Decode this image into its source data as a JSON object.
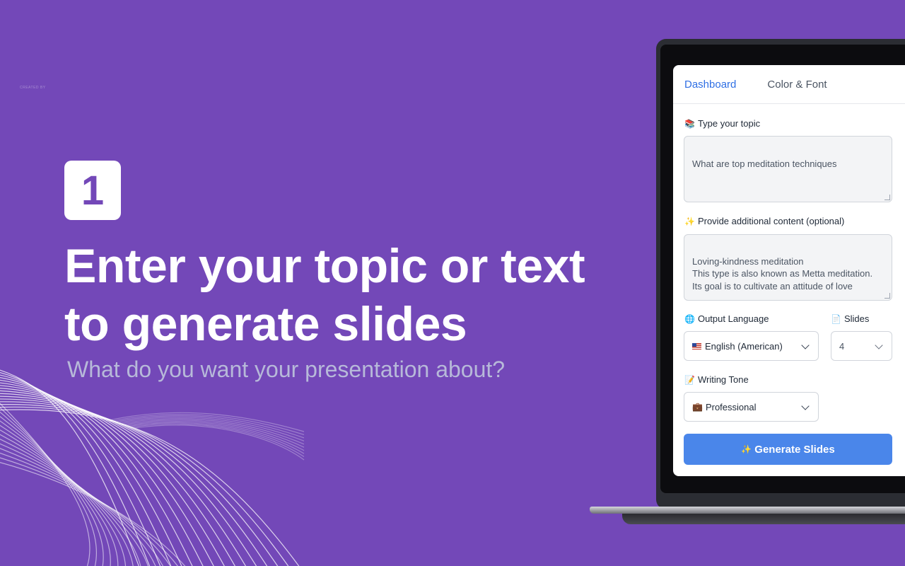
{
  "hero": {
    "created_by": "CREATED BY",
    "step_number": "1",
    "headline": "Enter your topic or text to generate slides",
    "subline": "What do you want your presentation about?"
  },
  "panel": {
    "tabs": [
      {
        "label": "Dashboard",
        "active": true
      },
      {
        "label": "Color & Font",
        "active": false
      }
    ],
    "topic": {
      "icon": "books-icon",
      "label": "Type your topic",
      "value": "What are top meditation techniques"
    },
    "additional": {
      "icon": "sparkles-icon",
      "label": "Provide additional content (optional)",
      "value": "Loving-kindness meditation\nThis type is also known as Metta meditation.\nIts goal is to cultivate an attitude of love"
    },
    "language": {
      "icon": "globe-icon",
      "label": "Output Language",
      "flag_icon": "us-flag-icon",
      "value": "English (American)"
    },
    "slides": {
      "icon": "page-icon",
      "label": "Slides",
      "value": "4"
    },
    "tone": {
      "icon": "memo-icon",
      "label": "Writing Tone",
      "value_icon": "briefcase-icon",
      "value": "Professional"
    },
    "generate_button": {
      "icon": "sparkles-icon",
      "label": "Generate Slides"
    }
  },
  "colors": {
    "background": "#7348b8",
    "accent_blue": "#2f6fe4",
    "button_blue": "#4a86ea",
    "subline_gray": "#b7b9d9"
  }
}
